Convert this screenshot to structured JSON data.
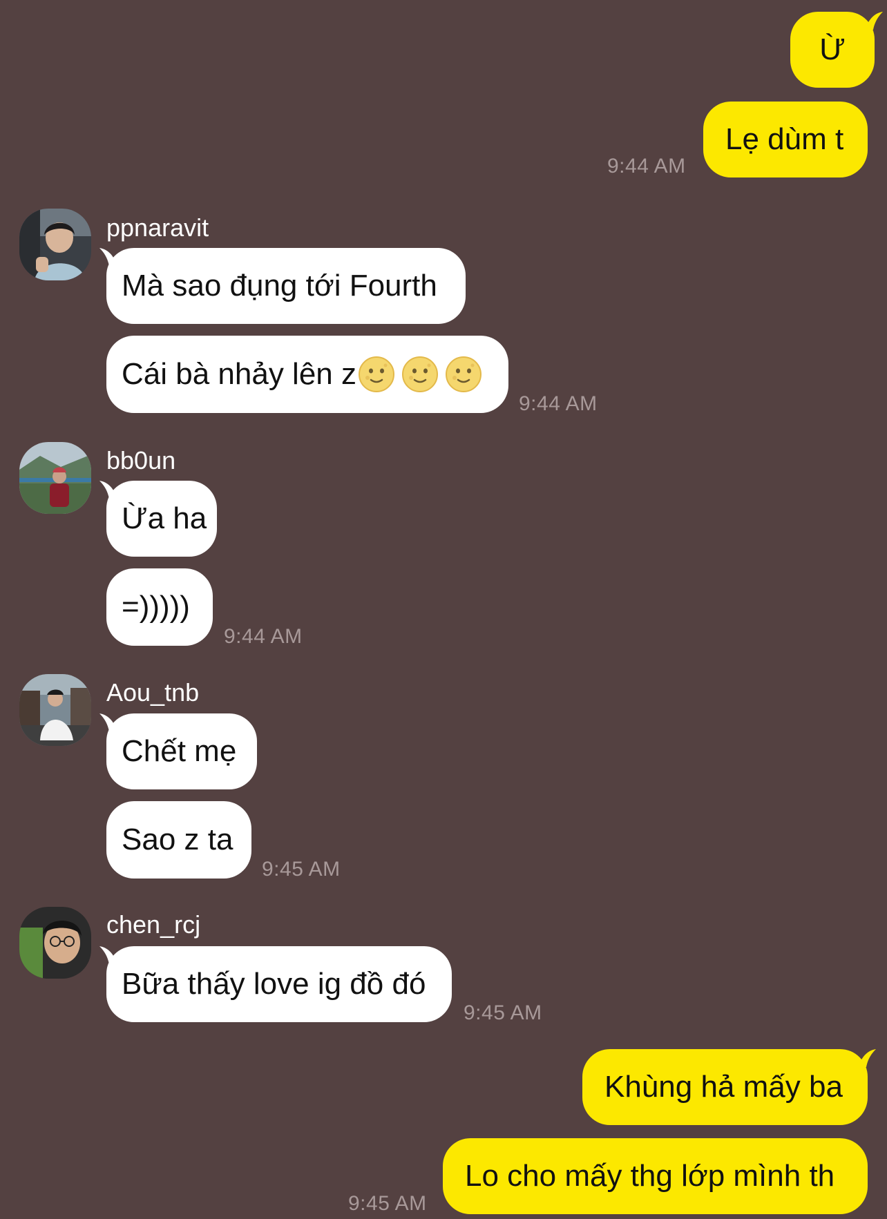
{
  "chat": {
    "outgoing_top": [
      {
        "text": "Ừ"
      },
      {
        "text": "Lẹ dùm t"
      }
    ],
    "outgoing_top_time": "9:44 AM",
    "groups": [
      {
        "sender": "ppnaravit",
        "avatar": "avatar-photo-ppnaravit",
        "messages": [
          "Mà sao đụng tới Fourth",
          "Cái bà nhảy lên z"
        ],
        "emoji": "full-moon-face-emoji",
        "time": "9:44 AM"
      },
      {
        "sender": "bb0un",
        "avatar": "avatar-photo-bb0un",
        "messages": [
          "Ừa ha",
          "=)))))"
        ],
        "time": "9:44 AM"
      },
      {
        "sender": "Aou_tnb",
        "avatar": "avatar-photo-aou-tnb",
        "messages": [
          "Chết mẹ",
          "Sao z ta"
        ],
        "time": "9:45 AM"
      },
      {
        "sender": "chen_rcj",
        "avatar": "avatar-photo-chen-rcj",
        "messages": [
          "Bữa thấy love ig đồ đó"
        ],
        "time": "9:45 AM"
      }
    ],
    "outgoing_bottom": [
      {
        "text": "Khùng hả mấy ba"
      },
      {
        "text": "Lo cho mấy thg lớp mình th"
      }
    ],
    "outgoing_bottom_time": "9:45 AM"
  },
  "colors": {
    "background": "#544141",
    "outgoing_bubble": "#fce800",
    "incoming_bubble": "#ffffff",
    "timestamp": "#a89999"
  }
}
